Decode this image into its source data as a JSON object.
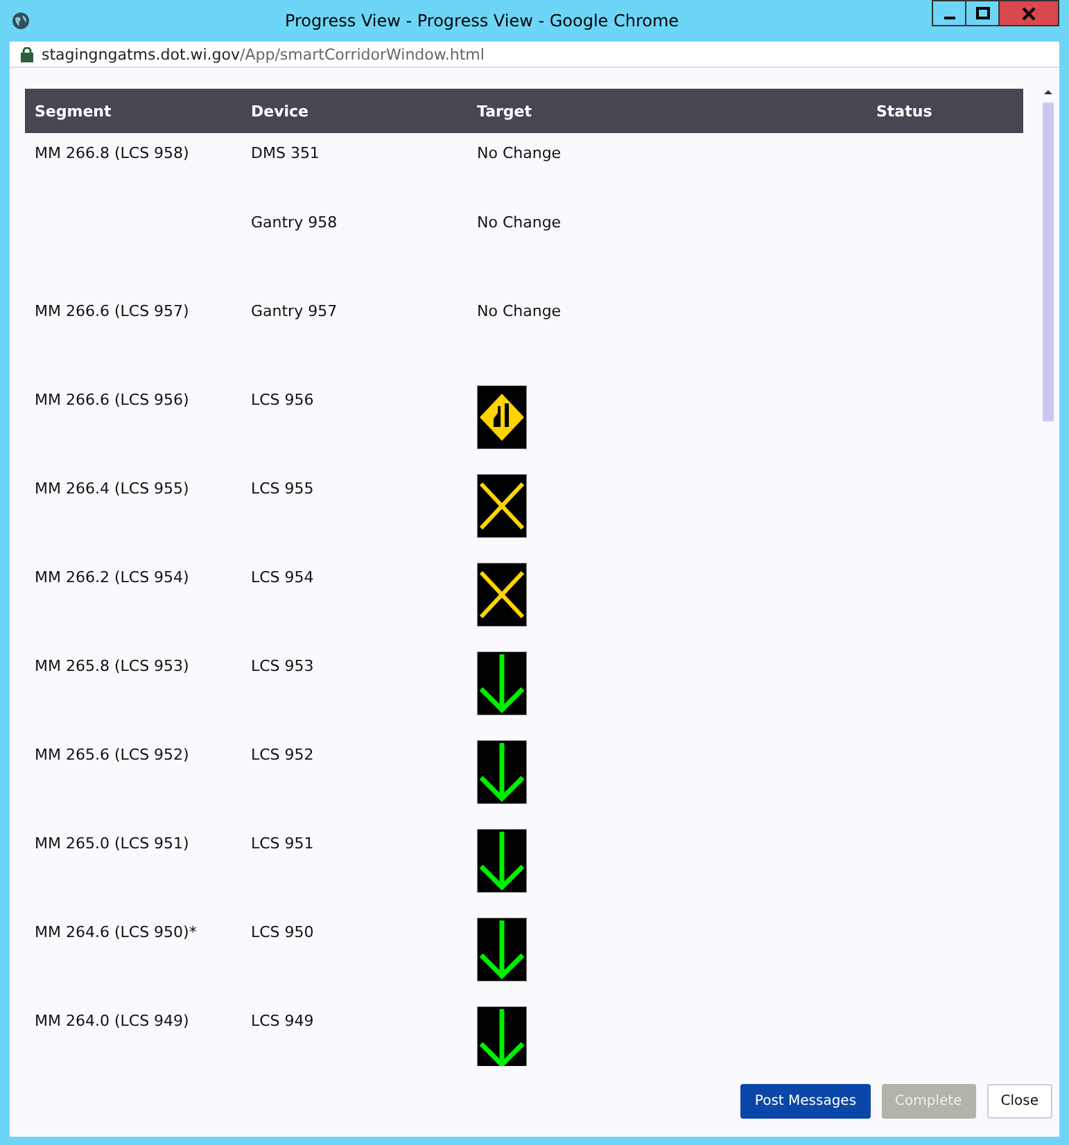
{
  "window": {
    "title": "Progress View - Progress View - Google Chrome",
    "url_host": "stagingngatms.dot.wi.gov",
    "url_path": "/App/smartCorridorWindow.html"
  },
  "table": {
    "columns": [
      "Segment",
      "Device",
      "Target",
      "Status"
    ],
    "rows": [
      {
        "segment": "MM 266.8 (LCS 958)",
        "device": "DMS 351",
        "target": {
          "kind": "text",
          "text": "No Change"
        }
      },
      {
        "segment": "",
        "device": "Gantry 958",
        "target": {
          "kind": "text",
          "text": "No Change"
        }
      },
      {
        "segment": "MM 266.6 (LCS 957)",
        "device": "Gantry 957",
        "target": {
          "kind": "text",
          "text": "No Change"
        }
      },
      {
        "segment": "MM 266.6 (LCS 956)",
        "device": "LCS 956",
        "target": {
          "kind": "merge"
        }
      },
      {
        "segment": "MM 266.4 (LCS 955)",
        "device": "LCS 955",
        "target": {
          "kind": "closed"
        }
      },
      {
        "segment": "MM 266.2 (LCS 954)",
        "device": "LCS 954",
        "target": {
          "kind": "closed"
        }
      },
      {
        "segment": "MM 265.8 (LCS 953)",
        "device": "LCS 953",
        "target": {
          "kind": "open"
        }
      },
      {
        "segment": "MM 265.6 (LCS 952)",
        "device": "LCS 952",
        "target": {
          "kind": "open"
        }
      },
      {
        "segment": "MM 265.0 (LCS 951)",
        "device": "LCS 951",
        "target": {
          "kind": "open"
        }
      },
      {
        "segment": "MM 264.6 (LCS 950)*",
        "device": "LCS 950",
        "target": {
          "kind": "open"
        }
      },
      {
        "segment": "MM 264.0 (LCS 949)",
        "device": "LCS 949",
        "target": {
          "kind": "open"
        }
      }
    ]
  },
  "buttons": [
    {
      "label": "Post Messages",
      "kind": "primary",
      "disabled": false
    },
    {
      "label": "Complete",
      "kind": "default",
      "disabled": true
    },
    {
      "label": "Close",
      "kind": "default",
      "disabled": false
    }
  ]
}
